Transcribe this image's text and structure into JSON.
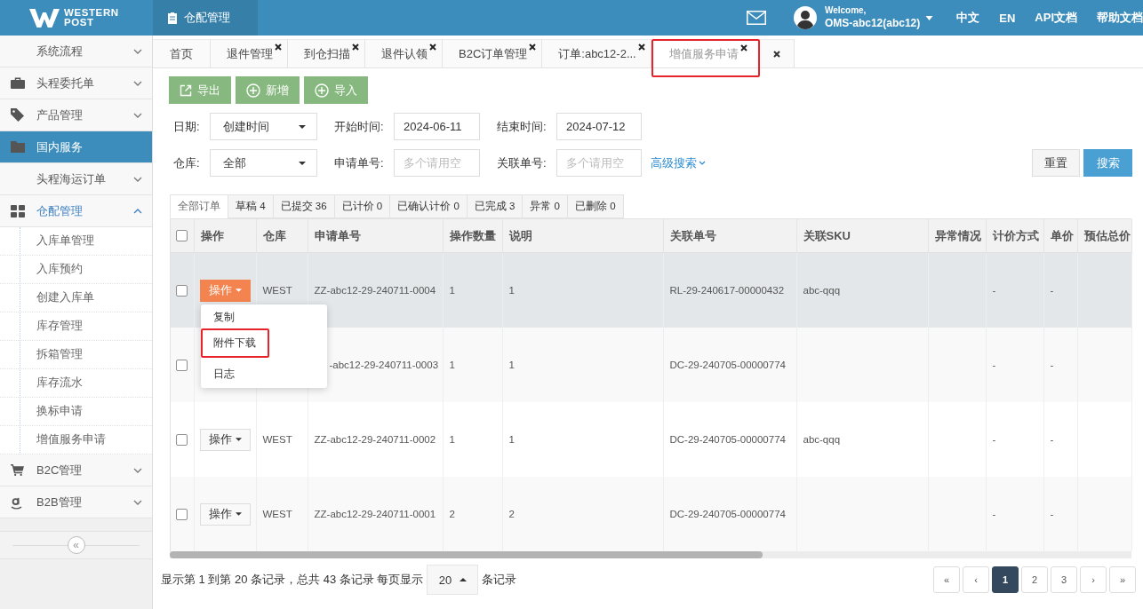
{
  "header": {
    "logo": [
      "WESTERN",
      "POST"
    ],
    "module": "仓配管理",
    "welcome": "Welcome,",
    "user": "OMS-abc12(abc12)",
    "links": [
      "中文",
      "EN",
      "API文档",
      "帮助文档"
    ]
  },
  "sidebar": {
    "items": [
      {
        "label": "系统流程",
        "kind": "menu",
        "selected": false,
        "expanded": false
      },
      {
        "label": "头程委托单",
        "kind": "menu",
        "selected": false,
        "expanded": false
      },
      {
        "label": "产品管理",
        "kind": "menu",
        "selected": false,
        "expanded": false
      },
      {
        "label": "国内服务",
        "kind": "link",
        "selected": true,
        "expanded": false
      },
      {
        "label": "头程海运订单",
        "kind": "menu",
        "selected": false,
        "expanded": false
      },
      {
        "label": "仓配管理",
        "kind": "menu",
        "selected": false,
        "expanded": true,
        "children": [
          {
            "label": "入库单管理",
            "selected": false
          },
          {
            "label": "入库预约",
            "selected": false
          },
          {
            "label": "创建入库单",
            "selected": false
          },
          {
            "label": "库存管理",
            "selected": false
          },
          {
            "label": "拆箱管理",
            "selected": false
          },
          {
            "label": "库存流水",
            "selected": false
          },
          {
            "label": "换标申请",
            "selected": false
          },
          {
            "label": "增值服务申请",
            "selected": false
          }
        ]
      },
      {
        "label": "B2C管理",
        "kind": "menu",
        "selected": false,
        "expanded": false
      },
      {
        "label": "B2B管理",
        "kind": "menu",
        "selected": false,
        "expanded": false
      }
    ],
    "collapse": "«"
  },
  "tabs": [
    {
      "label": "首页",
      "closable": false,
      "selected": false,
      "annotated": false
    },
    {
      "label": "退件管理",
      "closable": true,
      "selected": false,
      "annotated": false
    },
    {
      "label": "到仓扫描",
      "closable": true,
      "selected": false,
      "annotated": false
    },
    {
      "label": "退件认领",
      "closable": true,
      "selected": false,
      "annotated": false
    },
    {
      "label": "B2C订单管理",
      "closable": true,
      "selected": false,
      "annotated": false
    },
    {
      "label": "订单:abc12-2...",
      "closable": true,
      "selected": false,
      "annotated": false
    },
    {
      "label": "增值服务申请",
      "closable": true,
      "selected": true,
      "annotated": true
    }
  ],
  "close_all_tab": true,
  "toolbar": [
    "导出",
    "新增",
    "导入"
  ],
  "filters": [
    [
      {
        "label": "日期:",
        "kind": "select",
        "value": "创建时间"
      },
      {
        "label": "开始时间:",
        "kind": "input",
        "value": "2024-06-11"
      },
      {
        "label": "结束时间:",
        "kind": "input",
        "value": "2024-07-12"
      }
    ],
    [
      {
        "label": "仓库:",
        "kind": "select",
        "value": "全部"
      },
      {
        "label": "申请单号:",
        "kind": "input",
        "placeholder": "多个请用空"
      },
      {
        "label": "关联单号:",
        "kind": "input",
        "placeholder": "多个请用空"
      }
    ]
  ],
  "advanced_search": "高级搜索",
  "search_buttons": [
    {
      "label": "重置",
      "kind": "default"
    },
    {
      "label": "搜索",
      "kind": "primary"
    }
  ],
  "status_tabs": [
    {
      "label": "全部订单",
      "selected": true
    },
    {
      "label": "草稿",
      "count": "4",
      "selected": false
    },
    {
      "label": "已提交",
      "count": "36",
      "selected": false
    },
    {
      "label": "已计价",
      "count": "0",
      "selected": false
    },
    {
      "label": "已确认计价",
      "count": "0",
      "selected": false
    },
    {
      "label": "已完成",
      "count": "3",
      "selected": false
    },
    {
      "label": "异常",
      "count": "0",
      "selected": false
    },
    {
      "label": "已删除",
      "count": "0",
      "selected": false
    }
  ],
  "table": {
    "all_checked": false,
    "columns": [
      "操作",
      "仓库",
      "申请单号",
      "操作数量",
      "说明",
      "关联单号",
      "关联SKU",
      "异常情况",
      "计价方式",
      "单价",
      "预估总价"
    ],
    "rows": [
      {
        "checked": false,
        "hovered": true,
        "action": {
          "label": "操作",
          "open": true,
          "menu": [
            {
              "label": "复制",
              "annotated": false
            },
            {
              "label": "附件下载",
              "annotated": true
            },
            {
              "label": "日志",
              "annotated": false
            }
          ]
        },
        "warehouse": "WEST",
        "request_no": "ZZ-abc12-29-240711-0004",
        "quantity": "1",
        "note": "1",
        "related_no": "RL-29-240617-00000432",
        "related_sku": "abc-qqq",
        "pricing_method": "-",
        "unit_price": "-"
      },
      {
        "checked": false,
        "hovered": false,
        "request_no": "-abc12-29-240711-0003",
        "quantity": "1",
        "note": "1",
        "related_no": "DC-29-240705-00000774",
        "pricing_method": "-",
        "unit_price": "-"
      },
      {
        "checked": false,
        "hovered": false,
        "action": {
          "label": "操作",
          "open": false
        },
        "warehouse": "WEST",
        "request_no": "ZZ-abc12-29-240711-0002",
        "quantity": "1",
        "note": "1",
        "related_no": "DC-29-240705-00000774",
        "related_sku": "abc-qqq",
        "pricing_method": "-",
        "unit_price": "-"
      },
      {
        "checked": false,
        "hovered": false,
        "action": {
          "label": "操作",
          "open": false
        },
        "warehouse": "WEST",
        "request_no": "ZZ-abc12-29-240711-0001",
        "quantity": "2",
        "note": "2",
        "related_no": "DC-29-240705-00000774",
        "pricing_method": "-",
        "unit_price": "-"
      }
    ]
  },
  "pagination": {
    "summary": "显示第 1 到第 20 条记录，总共 43 条记录 每页显示",
    "page_size": "20",
    "suffix": "条记录",
    "pages": [
      {
        "label": "«",
        "selected": false
      },
      {
        "label": "‹",
        "selected": false
      },
      {
        "label": "1",
        "selected": true
      },
      {
        "label": "2",
        "selected": false
      },
      {
        "label": "3",
        "selected": false
      },
      {
        "label": "›",
        "selected": false
      },
      {
        "label": "»",
        "selected": false
      }
    ]
  }
}
